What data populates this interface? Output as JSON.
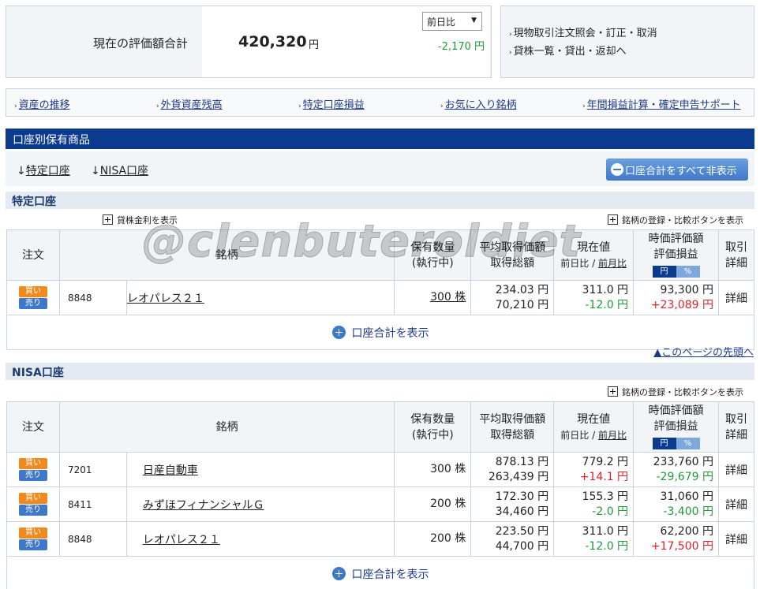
{
  "summary": {
    "label": "現在の評価額合計",
    "value": "420,320",
    "yen": "円",
    "compare_select": "前日比",
    "change": "-2,170 円"
  },
  "quick_links": [
    "現物取引注文照会・訂正・取消",
    "貸株一覧・貸出・返却へ"
  ],
  "nav": [
    "資産の推移",
    "外貨資産残高",
    "特定口座損益",
    "お気に入り銘柄",
    "年間損益計算・確定申告サポート"
  ],
  "holdings_title": "口座別保有商品",
  "anchors": {
    "tokutei": "特定口座",
    "nisa": "NISA口座"
  },
  "hide_button": "口座合計をすべて非表示",
  "tokutei": {
    "title": "特定口座",
    "lend_link": "貸株金利を表示",
    "register_link": "銘柄の登録・比較ボタンを表示",
    "total_link": "口座合計を表示"
  },
  "nisa": {
    "title": "NISA口座",
    "register_link": "銘柄の登録・比較ボタンを表示",
    "total_link": "口座合計を表示"
  },
  "headers": {
    "order": "注文",
    "name": "銘柄",
    "qty1": "保有数量",
    "qty2": "(執行中)",
    "avg1": "平均取得価額",
    "avg2": "取得総額",
    "cur1": "現在値",
    "cur_day": "前日比",
    "cur_sep": " / ",
    "cur_month": "前月比",
    "val1": "時価評価額",
    "val2": "評価損益",
    "toggle_yen": "円",
    "toggle_pct": "%",
    "trade1": "取引",
    "trade2": "詳細"
  },
  "buy_label": "買い",
  "sell_label": "売り",
  "detail_label": "詳細",
  "tokutei_rows": [
    {
      "code": "8848",
      "name": "レオパレス２１",
      "qty": "300 株",
      "avg": "234.03 円",
      "total": "70,210 円",
      "price": "311.0 円",
      "diff": "-12.0 円",
      "diff_sign": "neg",
      "value": "93,300 円",
      "pl": "+23,089 円",
      "pl_sign": "pos"
    }
  ],
  "nisa_rows": [
    {
      "code": "7201",
      "name": "日産自動車",
      "qty": "300 株",
      "avg": "878.13 円",
      "total": "263,439 円",
      "price": "779.2 円",
      "diff": "+14.1 円",
      "diff_sign": "pos",
      "value": "233,760 円",
      "pl": "-29,679 円",
      "pl_sign": "neg"
    },
    {
      "code": "8411",
      "name": "みずほフィナンシャルＧ",
      "qty": "200 株",
      "avg": "172.30 円",
      "total": "34,460 円",
      "price": "155.3 円",
      "diff": "-2.0 円",
      "diff_sign": "neg",
      "value": "31,060 円",
      "pl": "-3,400 円",
      "pl_sign": "neg"
    },
    {
      "code": "8848",
      "name": "レオパレス２１",
      "qty": "200 株",
      "avg": "223.50 円",
      "total": "44,700 円",
      "price": "311.0 円",
      "diff": "-12.0 円",
      "diff_sign": "neg",
      "value": "62,200 円",
      "pl": "+17,500 円",
      "pl_sign": "pos"
    }
  ],
  "to_top": "▲このページの先頭へ",
  "watermark": "@clenbuteroldiet"
}
